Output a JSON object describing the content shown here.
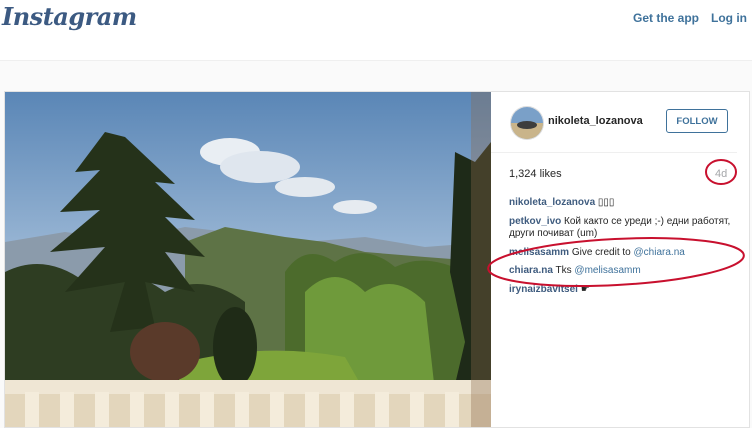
{
  "header": {
    "logo": "Instagram",
    "get_app": "Get the app",
    "login": "Log in"
  },
  "post": {
    "owner": "nikoleta_lozanova",
    "follow_label": "FOLLOW",
    "likes": "1,324 likes",
    "time": "4d",
    "comments": [
      {
        "user": "nikoleta_lozanova",
        "text": "▯▯▯"
      },
      {
        "user": "petkov_ivo",
        "text": "Кой както се уреди ;-) едни работят, други почиват (um)"
      },
      {
        "user": "melisasamm",
        "text": "Give credit to",
        "mention": "@chiara.na"
      },
      {
        "user": "chiara.na",
        "text": "Tks",
        "mention": "@melisasamm"
      },
      {
        "user": "irynaizbavitsel",
        "text": "☛"
      }
    ]
  },
  "colors": {
    "link": "#3f729b",
    "annotation": "#c8102e"
  }
}
